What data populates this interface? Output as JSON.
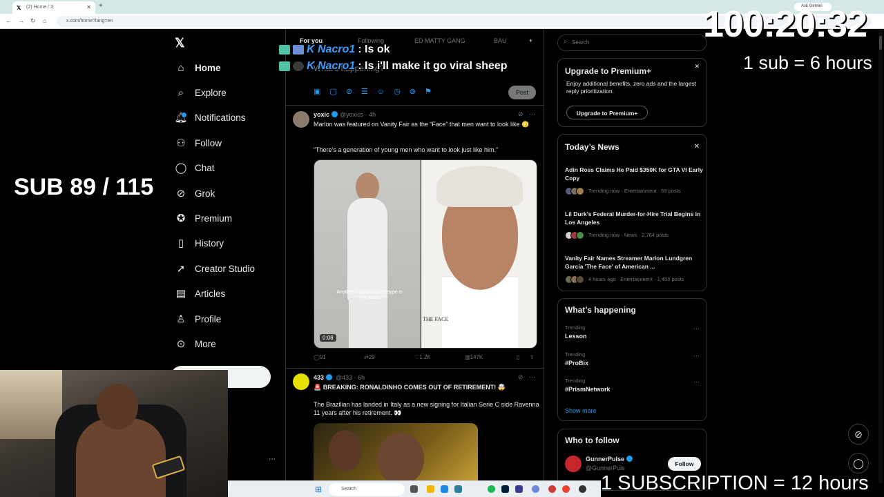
{
  "browser": {
    "tab_title": "(2) Home / X",
    "url": "x.com/home?lang=en",
    "ask_gemini": "Ask Gemini"
  },
  "nav": {
    "items": [
      {
        "label": "Home",
        "icon": "home-icon"
      },
      {
        "label": "Explore",
        "icon": "search-icon"
      },
      {
        "label": "Notifications",
        "icon": "bell-icon"
      },
      {
        "label": "Follow",
        "icon": "follow-icon"
      },
      {
        "label": "Chat",
        "icon": "chat-icon"
      },
      {
        "label": "Grok",
        "icon": "grok-icon"
      },
      {
        "label": "Premium",
        "icon": "premium-icon"
      },
      {
        "label": "History",
        "icon": "bookmark-icon"
      },
      {
        "label": "Creator Studio",
        "icon": "rocket-icon"
      },
      {
        "label": "Articles",
        "icon": "articles-icon"
      },
      {
        "label": "Profile",
        "icon": "profile-icon"
      },
      {
        "label": "More",
        "icon": "more-icon"
      }
    ]
  },
  "feed": {
    "tabs": [
      "For you",
      "Following",
      "ED MATTY GANG",
      "BAU"
    ],
    "compose_placeholder": "What's happening?",
    "post_label": "Post",
    "tweets": [
      {
        "name": "yoxic",
        "handle": "@yoxics · 4h",
        "text": "Marlon was featured on Vanity Fair as the “Face” that men want to look like 😳",
        "text2": "“There’s a generation of young men who want to look just like him.”",
        "media_caption": "Another important archetype is \"The Face.\"",
        "media_label": "THE FACE",
        "duration": "0:08",
        "replies": "91",
        "reposts": "29",
        "likes": "1.2K",
        "views": "147K"
      },
      {
        "name": "433",
        "handle": "@433 · 6h",
        "text": "🚨 BREAKING: RONALDINHO COMES OUT OF RETIREMENT! 🤯",
        "text2": "The Brazilian has landed in Italy as a new signing for Italian Serie C side Ravenna 11 years after his retirement. 👀"
      }
    ]
  },
  "sidebar": {
    "search_placeholder": "Search",
    "premium": {
      "title": "Upgrade to Premium+",
      "text": "Enjoy additional benefits, zero ads and the largest reply prioritization.",
      "button": "Upgrade to Premium+"
    },
    "news": {
      "title": "Today’s News",
      "items": [
        {
          "headline": "Adin Ross Claims He Paid $350K for GTA VI Early Copy",
          "meta": "Trending now · Entertainment · 59 posts"
        },
        {
          "headline": "Lil Durk’s Federal Murder-for-Hire Trial Begins in Los Angeles",
          "meta": "Trending now · News · 2,764 posts"
        },
        {
          "headline": "Vanity Fair Names Streamer Marlon Lundgren Garcia 'The Face' of American ...",
          "meta": "4 hours ago · Entertainment · 1,455 posts"
        }
      ]
    },
    "happening": {
      "title": "What’s happening",
      "items": [
        {
          "label": "Trending",
          "topic": "Lesson"
        },
        {
          "label": "Trending",
          "topic": "#ProBix"
        },
        {
          "label": "Trending",
          "topic": "#PrismNetwork"
        }
      ],
      "show_more": "Show more"
    },
    "follow": {
      "title": "Who to follow",
      "name": "GunnerPulse",
      "handle": "@GunnerPuls",
      "button": "Follow"
    }
  },
  "overlay": {
    "chat": [
      {
        "user": "K Nacro1",
        "message": ": Is ok"
      },
      {
        "user": "K Nacro1",
        "message": ": Is i'll make it go viral sheep"
      }
    ],
    "timer": "100:20:32",
    "sub_rate": "1 sub = 6 hours",
    "sub_count": "SUB 89 / 115",
    "subscription_rate": "1 SUBSCRIPTION = 12 hours"
  },
  "taskbar": {
    "search": "Search"
  },
  "colors": {
    "accent": "#1d9bf0",
    "background": "#000000",
    "border": "#2f3336",
    "muted": "#71767b"
  }
}
